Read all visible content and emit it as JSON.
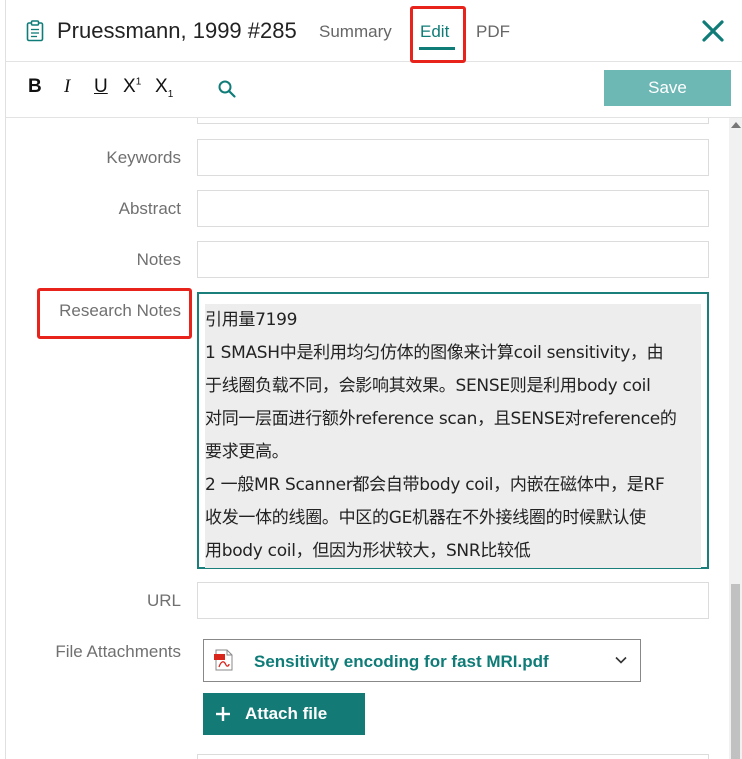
{
  "header": {
    "title": "Pruessmann, 1999 #285",
    "tabs": {
      "summary": "Summary",
      "edit": "Edit",
      "pdf": "PDF"
    },
    "close_icon": "close-icon"
  },
  "toolbar": {
    "bold": "B",
    "italic": "I",
    "underline": "U",
    "superscript": "X",
    "superscript_mark": "1",
    "subscript": "X",
    "subscript_mark": "1",
    "search_icon": "search-icon",
    "save_label": "Save"
  },
  "fields": {
    "keywords_label": "Keywords",
    "abstract_label": "Abstract",
    "notes_label": "Notes",
    "research_notes_label": "Research Notes",
    "research_notes_lines": [
      "引用量7199",
      "1 SMASH中是利用均匀仿体的图像来计算coil sensitivity，由",
      "于线圈负载不同，会影响其效果。SENSE则是利用body coil",
      "对同一层面进行额外reference scan，且SENSE对reference的",
      "要求更高。",
      "2 一般MR Scanner都会自带body coil，内嵌在磁体中，是RF",
      "收发一体的线圈。中区的GE机器在不外接线圈的时候默认使",
      "用body coil，但因为形状较大，SNR比较低"
    ],
    "url_label": "URL",
    "file_attachments_label": "File Attachments",
    "attachment_name": "Sensitivity encoding for fast MRI.pdf",
    "attach_file_label": "Attach file"
  },
  "colors": {
    "accent": "#0f7c78",
    "save_button": "#6db8b5",
    "highlight": "#e8231b"
  }
}
